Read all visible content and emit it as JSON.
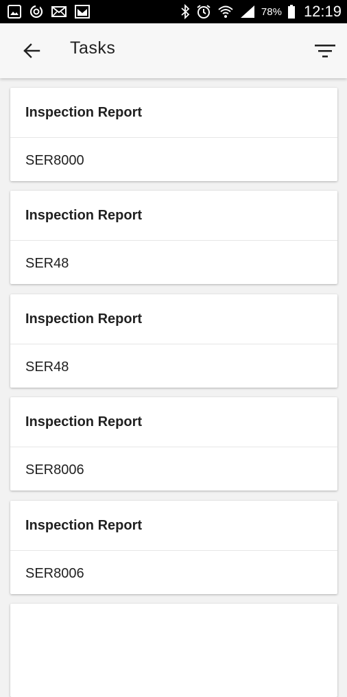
{
  "status_bar": {
    "icons_left": [
      "gallery-icon",
      "sync-icon",
      "mail-icon",
      "image-icon"
    ],
    "icons_right": [
      "bluetooth-icon",
      "alarm-icon",
      "wifi-icon",
      "signal-icon"
    ],
    "battery": "78%",
    "time": "12:19"
  },
  "app_bar": {
    "back_icon": "arrow-back-icon",
    "title": "Tasks",
    "filter_icon": "filter-icon"
  },
  "tasks": [
    {
      "title": "Inspection Report",
      "subtitle": "SER8000"
    },
    {
      "title": "Inspection Report",
      "subtitle": "SER48"
    },
    {
      "title": "Inspection Report",
      "subtitle": "SER48"
    },
    {
      "title": "Inspection Report",
      "subtitle": "SER8006"
    },
    {
      "title": "Inspection Report",
      "subtitle": "SER8006"
    }
  ],
  "colors": {
    "status_bar": "#000000",
    "app_bar": "#f7f7f7",
    "background": "#f2f2f2",
    "card": "#ffffff",
    "text": "#212121"
  }
}
